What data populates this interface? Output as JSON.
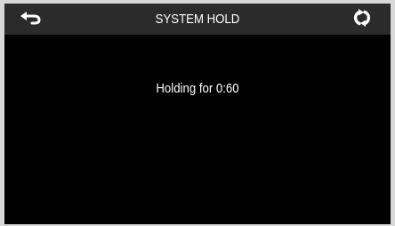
{
  "header": {
    "title": "SYSTEM HOLD",
    "back_icon": "back-arrow-icon",
    "refresh_icon": "refresh-icon"
  },
  "main": {
    "message": "Holding for 0:60"
  },
  "colors": {
    "background": "#000000",
    "header_bg": "#2b2b2b",
    "text": "#ffffff"
  }
}
